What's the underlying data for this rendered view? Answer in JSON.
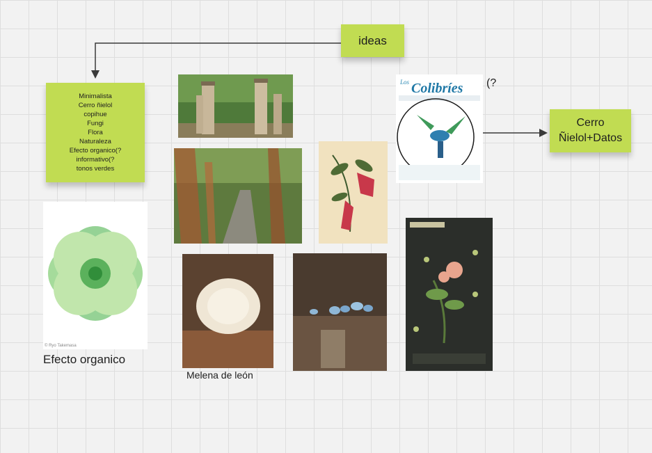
{
  "board": {
    "sticky_ideas": "ideas",
    "sticky_list": [
      "Minimalista",
      "Cerro ñielol",
      "copihue",
      "Fungi",
      "Flora",
      "Naturaleza",
      "Efecto organico(?",
      "informativo(?",
      "tonos verdes"
    ],
    "sticky_cerro": [
      "Cerro",
      "Ñielol+Datos"
    ],
    "caption_efecto": "Efecto organico",
    "caption_melena": "Melena de león",
    "caption_question": "(?",
    "image_colibries_title": "Colibríes",
    "image_colibries_prefix": "Los",
    "image_credit": "© Ryo Takemasa"
  },
  "colors": {
    "sticky": "#c1dc52",
    "grid": "#dedede",
    "canvas": "#f2f2f2",
    "connector": "#3a3a3a"
  }
}
